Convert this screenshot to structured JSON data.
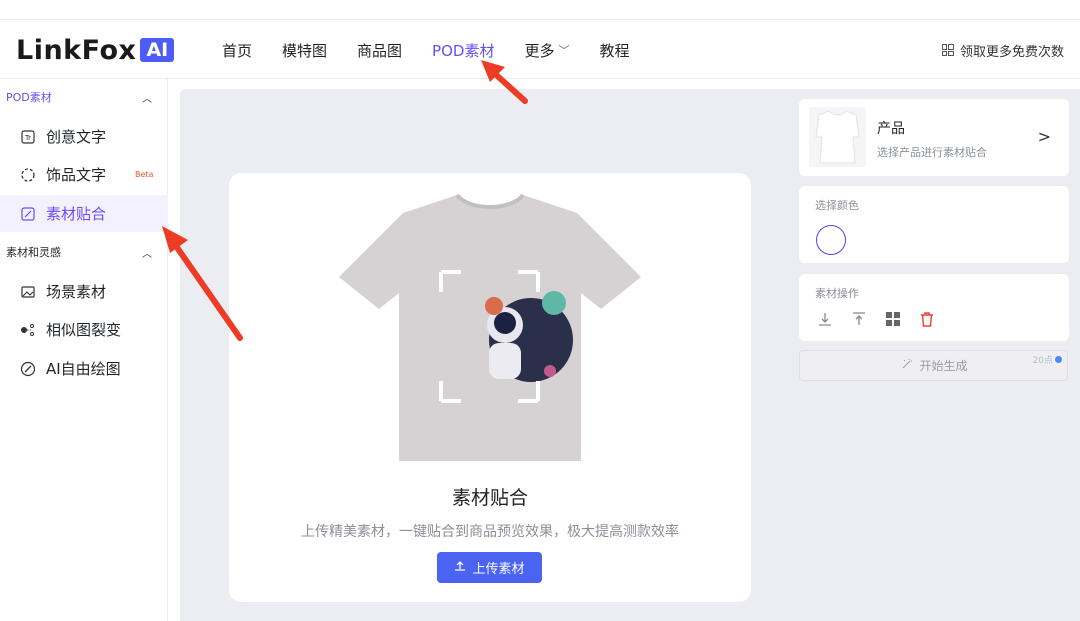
{
  "header": {
    "logo_text": "LinkFox",
    "logo_badge": "AI",
    "nav": [
      "首页",
      "模特图",
      "商品图",
      "POD素材",
      "更多",
      "教程"
    ],
    "active_nav": "POD素材",
    "promo_text": "领取更多免费次数"
  },
  "sidebar": {
    "section1": "POD素材",
    "section1_items": [
      {
        "label": "创意文字",
        "icon": "text-tt-icon"
      },
      {
        "label": "饰品文字",
        "icon": "dashed-circle-icon",
        "badge": "Beta"
      },
      {
        "label": "素材贴合",
        "icon": "sticker-icon",
        "active": true
      }
    ],
    "section2": "素材和灵感",
    "section2_items": [
      {
        "label": "场景素材",
        "icon": "image-icon"
      },
      {
        "label": "相似图裂变",
        "icon": "share-nodes-icon"
      },
      {
        "label": "AI自由绘图",
        "icon": "pen-icon"
      }
    ]
  },
  "main": {
    "card_title": "素材贴合",
    "card_desc": "上传精美素材，一键贴合到商品预览效果，极大提高测款效率",
    "upload_label": "上传素材"
  },
  "panel": {
    "product_title": "产品",
    "product_sub": "选择产品进行素材贴合",
    "color_label": "选择颜色",
    "ops_label": "素材操作",
    "generate_label": "开始生成",
    "generate_cost": "20点"
  },
  "colors": {
    "accent": "#6a4cf5",
    "button": "#4a63f0",
    "arrow": "#ee3b24",
    "delete": "#e8402c"
  }
}
